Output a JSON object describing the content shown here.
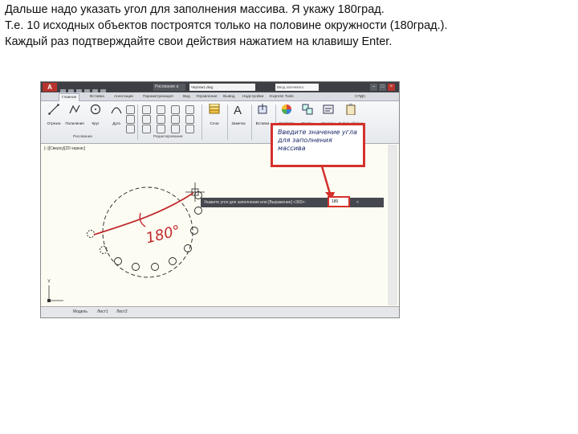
{
  "caption": {
    "line1": "Дальше надо указать угол для заполнения массива. Я укажу 180град.",
    "line2": "Т.е. 10 исходных объектов построятся только на половине окружности (180град.).",
    "line3": "Каждый раз подтверждайте свои действия нажатием на клавишу Enter."
  },
  "window": {
    "title": "Чертеж1.dwg",
    "workspace": "Рисование и",
    "search_placeholder": "Ввод ключевого",
    "app_button": "A"
  },
  "ribbon": {
    "tabs": [
      "Главная",
      "Вставка",
      "Аннотации",
      "Параметризация",
      "Вид",
      "Управление",
      "Вывод",
      "Надстройки",
      "Express Tools",
      "СПДС"
    ],
    "tools": {
      "line": "Отрезок",
      "polyline": "Полилиния",
      "circle": "Круг",
      "arc": "Дуга",
      "layers": "Слои",
      "text": "Заметка",
      "insert": "Вставка",
      "properties": "Свойства",
      "groups": "Группы",
      "utilities": "Утилиты",
      "clipboard": "Буфер обмена"
    },
    "panels": {
      "draw": "Рисование",
      "modify": "Редактирование"
    }
  },
  "viewport": {
    "label": "[−][Сверху][2D каркас]",
    "layout_tabs": [
      "Модель",
      "Лист1",
      "Лист2"
    ],
    "ucs_y": "Y"
  },
  "callout": {
    "text": "Введите значение угла для заполнения массива"
  },
  "prompt": {
    "text": "Укажите угол для заполнения или [Выражение] <360>:",
    "value": "180",
    "unit": "<"
  },
  "annotation": {
    "angle_label": "180°"
  },
  "colors": {
    "callout_border": "#d4302b",
    "annotation_red": "#c0282d",
    "callout_text": "#1a2a6a",
    "viewport_bg": "#fdfcf2"
  }
}
